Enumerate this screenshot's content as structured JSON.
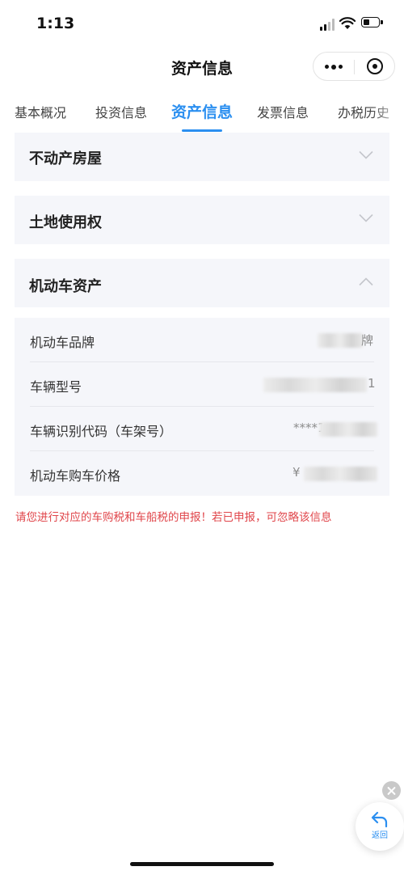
{
  "status_bar": {
    "time": "1:13"
  },
  "navbar": {
    "title": "资产信息"
  },
  "tabs": [
    {
      "label": "基本概况",
      "active": false
    },
    {
      "label": "投资信息",
      "active": false
    },
    {
      "label": "资产信息",
      "active": true
    },
    {
      "label": "发票信息",
      "active": false
    },
    {
      "label": "办税历史",
      "active": false
    }
  ],
  "sections": {
    "real_estate": {
      "title": "不动产房屋",
      "expanded": false
    },
    "land_use": {
      "title": "土地使用权",
      "expanded": false
    },
    "vehicle": {
      "title": "机动车资产",
      "expanded": true
    }
  },
  "vehicle_details": [
    {
      "label": "机动车品牌",
      "value_visible": "牌"
    },
    {
      "label": "车辆型号",
      "value_visible": "1"
    },
    {
      "label": "车辆识别代码（车架号）",
      "value_visible": "****1"
    },
    {
      "label": "机动车购车价格",
      "value_visible": "¥"
    }
  ],
  "notice": "请您进行对应的车购税和车船税的申报！若已申报，可忽略该信息",
  "floating": {
    "back_label": "返回"
  },
  "colors": {
    "accent": "#2b8ff0",
    "warning": "#e0454a",
    "panel_bg": "#f5f6fa"
  }
}
